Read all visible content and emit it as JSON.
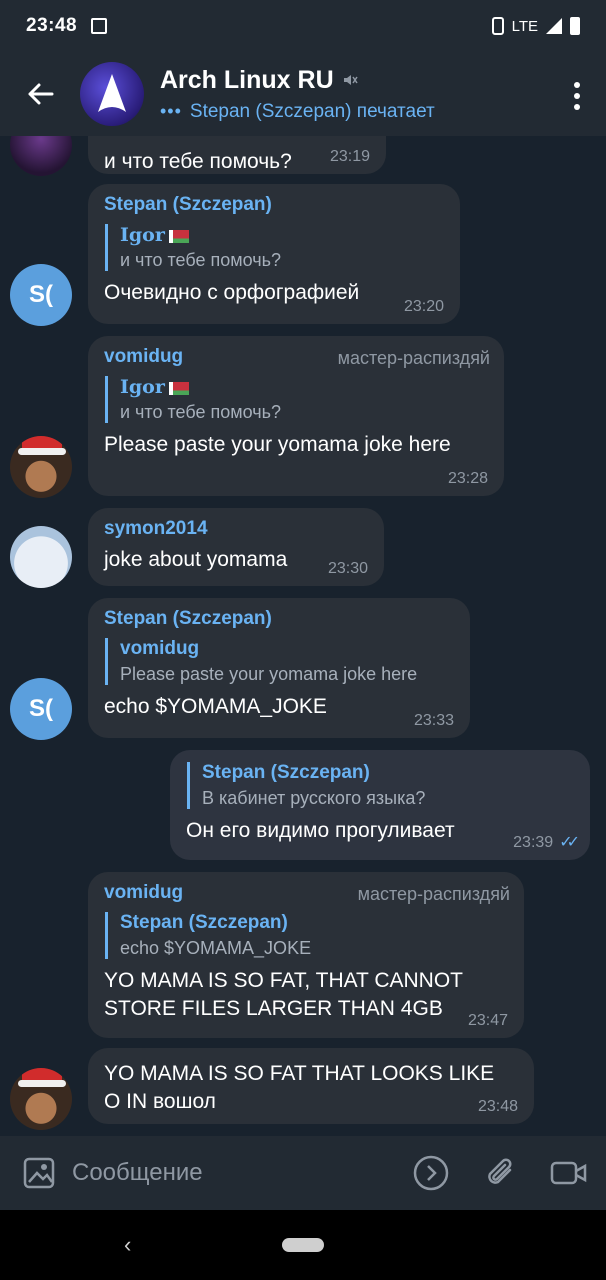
{
  "status_bar": {
    "time": "23:48",
    "network": "LTE"
  },
  "header": {
    "title": "Arch Linux RU",
    "status": "Stepan (Szczepan) печатает"
  },
  "messages": [
    {
      "text": "и что тебе помочь?",
      "time": "23:19"
    },
    {
      "sender": "Stepan (Szczepan)",
      "avatar_text": "S(",
      "reply_name": "Igor",
      "reply_text": "и что тебе помочь?",
      "text": "Очевидно с орфографией",
      "time": "23:20"
    },
    {
      "sender": "vomidug",
      "role": "мастер-распиздяй",
      "reply_name": "Igor",
      "reply_text": "и что тебе помочь?",
      "text": "Please paste your yomama joke here",
      "time": "23:28"
    },
    {
      "sender": "symon2014",
      "text": "joke about yomama",
      "time": "23:30"
    },
    {
      "sender": "Stepan (Szczepan)",
      "avatar_text": "S(",
      "reply_name": "vomidug",
      "reply_text": "Please paste your yomama joke here",
      "text": "echo $YOMAMA_JOKE",
      "time": "23:33"
    },
    {
      "reply_name": "Stepan (Szczepan)",
      "reply_text": "В кабинет русского языка?",
      "text": "Он его видимо прогуливает",
      "time": "23:39"
    },
    {
      "sender": "vomidug",
      "role": "мастер-распиздяй",
      "reply_name": "Stepan (Szczepan)",
      "reply_text": "echo $YOMAMA_JOKE",
      "text_lines": [
        "YO MAMA IS SO FAT, THAT CANNOT",
        "STORE FILES LARGER THAN 4GB"
      ],
      "time": "23:47"
    },
    {
      "text_lines": [
        "YO MAMA IS SO FAT THAT LOOKS LIKE",
        "O IN вошол"
      ],
      "time": "23:48"
    }
  ],
  "input": {
    "placeholder": "Сообщение"
  },
  "colors": {
    "accent": "#6ab3f3",
    "bubble": "#2a3038",
    "background": "#18222d"
  }
}
